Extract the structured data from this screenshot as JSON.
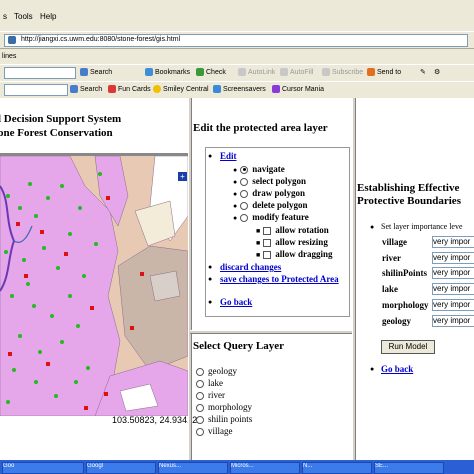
{
  "menu": {
    "items": [
      "s",
      "Tools",
      "Help"
    ]
  },
  "address": {
    "url": "http://jiangxi.cs.uwm.edu:8080/stone-forest/gis.html"
  },
  "links_bar": {
    "label": "lines"
  },
  "toolbar1": {
    "search": "Search",
    "bookmarks": "Bookmarks",
    "check": "Check",
    "autolink": "AutoLink",
    "autofill": "AutoFill",
    "subscribe": "Subscribe",
    "sendto": "Send to"
  },
  "toolbar2": {
    "search": "Search",
    "funcards": "Fun Cards",
    "smiley": "Smiley Central",
    "screensavers": "Screensavers",
    "cursormania": "Cursor Mania"
  },
  "map": {
    "title_line1": "l Decision Support System",
    "title_line2": "one Forest Conservation",
    "coordinates": "103.50823, 24.93412"
  },
  "edit_panel": {
    "heading": "Edit the protected area layer",
    "edit_link": "Edit",
    "options": [
      "navigate",
      "select polygon",
      "draw polygon",
      "delete polygon",
      "modify feature"
    ],
    "selected": "navigate",
    "modify_options": [
      "allow rotation",
      "allow resizing",
      "allow dragging"
    ],
    "discard": "discard changes",
    "save": "save changes to Protected Area",
    "go_back": "Go back"
  },
  "query_panel": {
    "heading": "Select Query Layer",
    "layers": [
      "geology",
      "lake",
      "river",
      "morphology",
      "shilin points",
      "village"
    ]
  },
  "boundaries_panel": {
    "heading_line1": "Establishing Effective",
    "heading_line2": "Protective Boundaries",
    "importance_label": "Set layer importance leve",
    "layers": [
      {
        "name": "village",
        "value": "very impor"
      },
      {
        "name": "river",
        "value": "very impor"
      },
      {
        "name": "shilinPoints",
        "value": "very impor"
      },
      {
        "name": "lake",
        "value": "very impor"
      },
      {
        "name": "morphology",
        "value": "very impor"
      },
      {
        "name": "geology",
        "value": "very impor"
      }
    ],
    "run_button": "Run Model",
    "go_back": "Go back"
  },
  "taskbar": {
    "items": [
      "Goo",
      "Googl",
      "Nexus...",
      "Micros...",
      "N...",
      "SE..."
    ]
  }
}
